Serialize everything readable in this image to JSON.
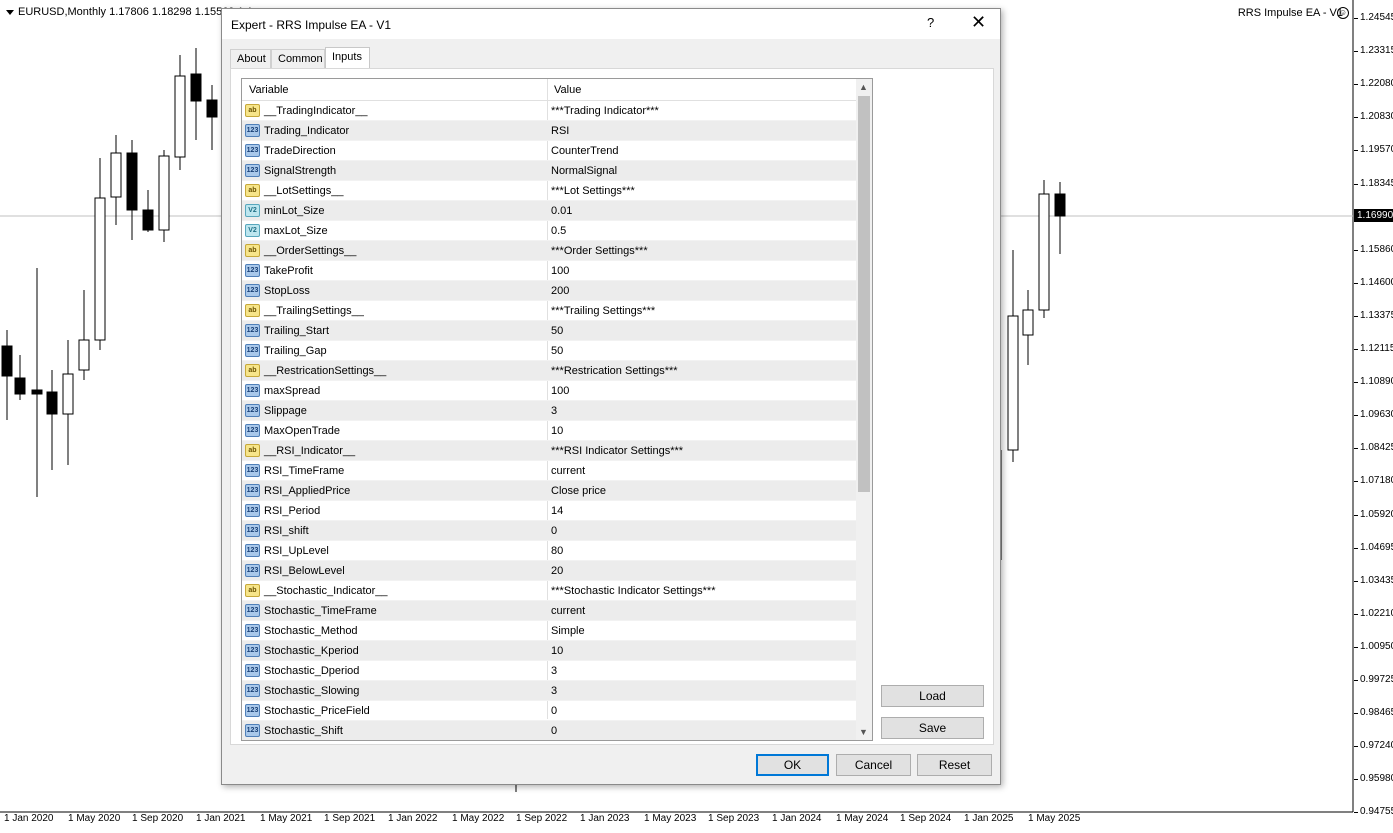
{
  "chart": {
    "symbol_line": "EURUSD,Monthly  1.17806 1.18298 1.15569 1.1",
    "ea_label": "RRS Impulse EA - V1",
    "current_price": "1.16990",
    "y_ticks": [
      "1.24545",
      "1.23315",
      "1.22080",
      "1.20830",
      "1.19570",
      "1.18345",
      "1.15860",
      "1.14600",
      "1.13375",
      "1.12115",
      "1.10890",
      "1.09630",
      "1.08425",
      "1.07180",
      "1.05920",
      "1.04695",
      "1.03435",
      "1.02210",
      "1.00950",
      "0.99725",
      "0.98465",
      "0.97240",
      "0.95980",
      "0.94755"
    ],
    "x_ticks": [
      "1 Jan 2020",
      "1 May 2020",
      "1 Sep 2020",
      "1 Jan 2021",
      "1 May 2021",
      "1 Sep 2021",
      "1 Jan 2022",
      "1 May 2022",
      "1 Sep 2022",
      "1 Jan 2023",
      "1 May 2023",
      "1 Sep 2023",
      "1 Jan 2024",
      "1 May 2024",
      "1 Sep 2024",
      "1 Jan 2025",
      "1 May 2025"
    ]
  },
  "dialog": {
    "title": "Expert - RRS Impulse EA - V1",
    "help": "?",
    "close": "✕",
    "tabs": [
      "About",
      "Common",
      "Inputs"
    ],
    "active_tab": "Inputs",
    "col_variable": "Variable",
    "col_value": "Value",
    "rows": [
      {
        "icon": "ab",
        "name": "__TradingIndicator__",
        "value": "***Trading Indicator***"
      },
      {
        "icon": "123",
        "name": "Trading_Indicator",
        "value": "RSI"
      },
      {
        "icon": "123",
        "name": "TradeDirection",
        "value": "CounterTrend"
      },
      {
        "icon": "123",
        "name": "SignalStrength",
        "value": "NormalSignal"
      },
      {
        "icon": "ab",
        "name": "__LotSettings__",
        "value": "***Lot Settings***"
      },
      {
        "icon": "V2",
        "name": "minLot_Size",
        "value": "0.01"
      },
      {
        "icon": "V2",
        "name": "maxLot_Size",
        "value": "0.5"
      },
      {
        "icon": "ab",
        "name": "__OrderSettings__",
        "value": "***Order Settings***"
      },
      {
        "icon": "123",
        "name": "TakeProfit",
        "value": "100"
      },
      {
        "icon": "123",
        "name": "StopLoss",
        "value": "200"
      },
      {
        "icon": "ab",
        "name": "__TrailingSettings__",
        "value": "***Trailing Settings***"
      },
      {
        "icon": "123",
        "name": "Trailing_Start",
        "value": "50"
      },
      {
        "icon": "123",
        "name": "Trailing_Gap",
        "value": "50"
      },
      {
        "icon": "ab",
        "name": "__RestricationSettings__",
        "value": "***Restrication Settings***"
      },
      {
        "icon": "123",
        "name": "maxSpread",
        "value": "100"
      },
      {
        "icon": "123",
        "name": "Slippage",
        "value": "3"
      },
      {
        "icon": "123",
        "name": "MaxOpenTrade",
        "value": "10"
      },
      {
        "icon": "ab",
        "name": "__RSI_Indicator__",
        "value": "***RSI Indicator Settings***"
      },
      {
        "icon": "123",
        "name": "RSI_TimeFrame",
        "value": "current"
      },
      {
        "icon": "123",
        "name": "RSI_AppliedPrice",
        "value": "Close price"
      },
      {
        "icon": "123",
        "name": "RSI_Period",
        "value": "14"
      },
      {
        "icon": "123",
        "name": "RSI_shift",
        "value": "0"
      },
      {
        "icon": "123",
        "name": "RSI_UpLevel",
        "value": "80"
      },
      {
        "icon": "123",
        "name": "RSI_BelowLevel",
        "value": "20"
      },
      {
        "icon": "ab",
        "name": "__Stochastic_Indicator__",
        "value": "***Stochastic Indicator Settings***"
      },
      {
        "icon": "123",
        "name": "Stochastic_TimeFrame",
        "value": "current"
      },
      {
        "icon": "123",
        "name": "Stochastic_Method",
        "value": "Simple"
      },
      {
        "icon": "123",
        "name": "Stochastic_Kperiod",
        "value": "10"
      },
      {
        "icon": "123",
        "name": "Stochastic_Dperiod",
        "value": "3"
      },
      {
        "icon": "123",
        "name": "Stochastic_Slowing",
        "value": "3"
      },
      {
        "icon": "123",
        "name": "Stochastic_PriceField",
        "value": "0"
      },
      {
        "icon": "123",
        "name": "Stochastic_Shift",
        "value": "0"
      }
    ],
    "buttons": {
      "load": "Load",
      "save": "Save",
      "ok": "OK",
      "cancel": "Cancel",
      "reset": "Reset"
    }
  }
}
